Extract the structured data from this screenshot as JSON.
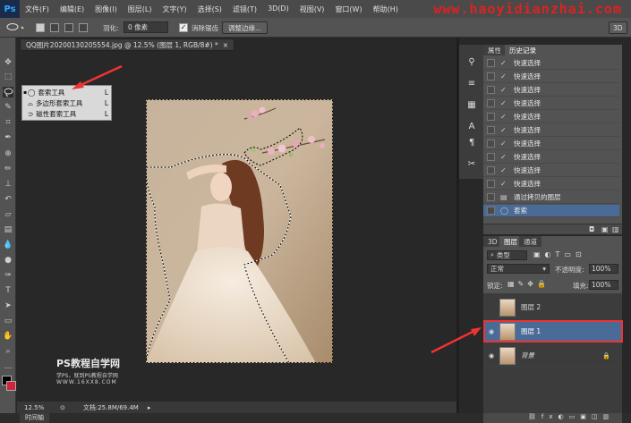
{
  "menu": {
    "logo": "Ps",
    "items": [
      "文件(F)",
      "编辑(E)",
      "图像(I)",
      "图层(L)",
      "文字(Y)",
      "选择(S)",
      "滤镜(T)",
      "3D(D)",
      "视图(V)",
      "窗口(W)",
      "帮助(H)"
    ],
    "watermark": "www.haoyidianzhai.com"
  },
  "options": {
    "feather_label": "羽化:",
    "feather_value": "0 像素",
    "antialias_label": "消除锯齿",
    "refine_edge": "调整边缘...",
    "workspace": "3D"
  },
  "document": {
    "tab_title": "QQ图片20200130205554.jpg @ 12.5% (图层 1, RGB/8#) *",
    "close": "×"
  },
  "flyout": {
    "items": [
      {
        "label": "套索工具",
        "key": "L",
        "icon": "lasso-icon"
      },
      {
        "label": "多边形套索工具",
        "key": "L",
        "icon": "polygon-lasso-icon"
      },
      {
        "label": "磁性套索工具",
        "key": "L",
        "icon": "magnetic-lasso-icon"
      }
    ]
  },
  "status": {
    "zoom": "12.5%",
    "doc_info": "文档:25.8M/69.4M",
    "timeline": "时间轴"
  },
  "watermark_logo": {
    "title": "PS教程自学网",
    "line2": "学PS，就到PS教程自学网",
    "line3": "WWW.16XX8.COM"
  },
  "history_panel": {
    "tabs": [
      "属性",
      "历史记录"
    ],
    "rows": [
      {
        "label": "快速选择",
        "icon": "quick-select-icon"
      },
      {
        "label": "快速选择",
        "icon": "quick-select-icon"
      },
      {
        "label": "快速选择",
        "icon": "quick-select-icon"
      },
      {
        "label": "快速选择",
        "icon": "quick-select-icon"
      },
      {
        "label": "快速选择",
        "icon": "quick-select-icon"
      },
      {
        "label": "快速选择",
        "icon": "quick-select-icon"
      },
      {
        "label": "快速选择",
        "icon": "quick-select-icon"
      },
      {
        "label": "快速选择",
        "icon": "quick-select-icon"
      },
      {
        "label": "快速选择",
        "icon": "quick-select-icon"
      },
      {
        "label": "快速选择",
        "icon": "quick-select-icon"
      },
      {
        "label": "通过拷贝的图层",
        "icon": "layer-icon"
      },
      {
        "label": "套索",
        "icon": "lasso-icon"
      }
    ]
  },
  "layers_panel": {
    "tabs": [
      "3D",
      "图层",
      "通道"
    ],
    "filter_label": "类型",
    "blend_mode": "正常",
    "opacity_label": "不透明度:",
    "opacity_value": "100%",
    "lock_label": "锁定:",
    "fill_label": "填充:",
    "fill_value": "100%",
    "layers": [
      {
        "name": "图层 2",
        "visible": false,
        "selected": false
      },
      {
        "name": "图层 1",
        "visible": true,
        "selected": true
      },
      {
        "name": "背景",
        "visible": true,
        "selected": false,
        "locked": true
      }
    ]
  },
  "colors": {
    "accent_selected": "#4a6a98",
    "annotation_red": "#e33333"
  }
}
